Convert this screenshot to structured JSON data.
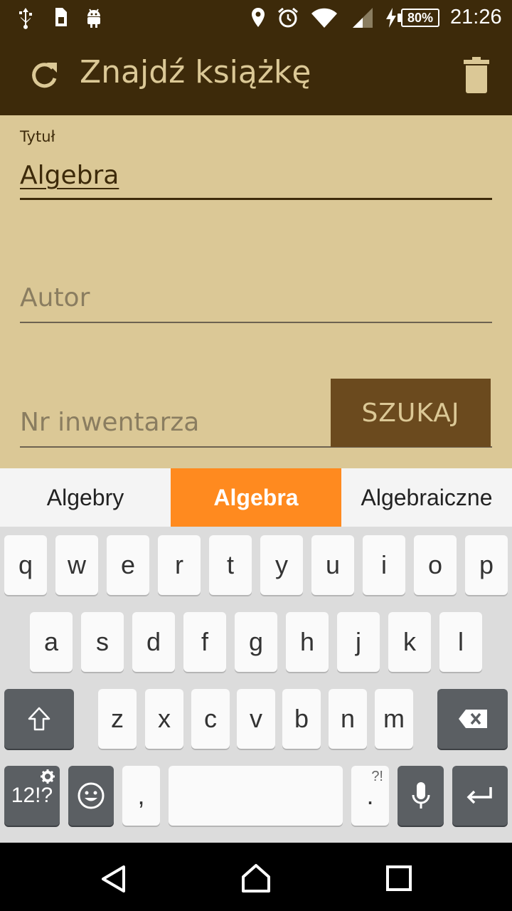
{
  "status_bar": {
    "icons": [
      "usb-icon",
      "sim-card-icon",
      "android-icon",
      "location-icon",
      "alarm-icon",
      "wifi-icon",
      "signal-icon",
      "charging-icon"
    ],
    "battery": "80%",
    "time": "21:26"
  },
  "app_bar": {
    "title": "Znajdź książkę",
    "refresh_icon": "refresh-icon",
    "delete_icon": "trash-icon",
    "background": "#3d2a0a",
    "accent": "#dbc896"
  },
  "form": {
    "title_label": "Tytuł",
    "title_value": "Algebra",
    "author_placeholder": "Autor",
    "inventory_placeholder": "Nr inwentarza",
    "search_button": "SZUKAJ",
    "background": "#dbc896",
    "button_color": "#6b4a1e"
  },
  "suggestions": {
    "items": [
      "Algebry",
      "Algebra",
      "Algebraiczne"
    ],
    "selected": "Algebra",
    "selected_color": "#ff8a1f"
  },
  "keyboard": {
    "row1": [
      "q",
      "w",
      "e",
      "r",
      "t",
      "y",
      "u",
      "i",
      "o",
      "p"
    ],
    "row2": [
      "a",
      "s",
      "d",
      "f",
      "g",
      "h",
      "j",
      "k",
      "l"
    ],
    "row3": [
      "z",
      "x",
      "c",
      "v",
      "b",
      "n",
      "m"
    ],
    "symbols_key": "12!?",
    "comma_key": ",",
    "period_key": ".",
    "period_hint": "?!",
    "shift_icon": "shift-icon",
    "backspace_icon": "backspace-icon",
    "emoji_icon": "emoji-icon",
    "mic_icon": "microphone-icon",
    "enter_icon": "enter-icon",
    "settings_icon": "gear-icon"
  },
  "nav_bar": {
    "icons": [
      "back-icon",
      "home-icon",
      "recents-icon"
    ]
  }
}
